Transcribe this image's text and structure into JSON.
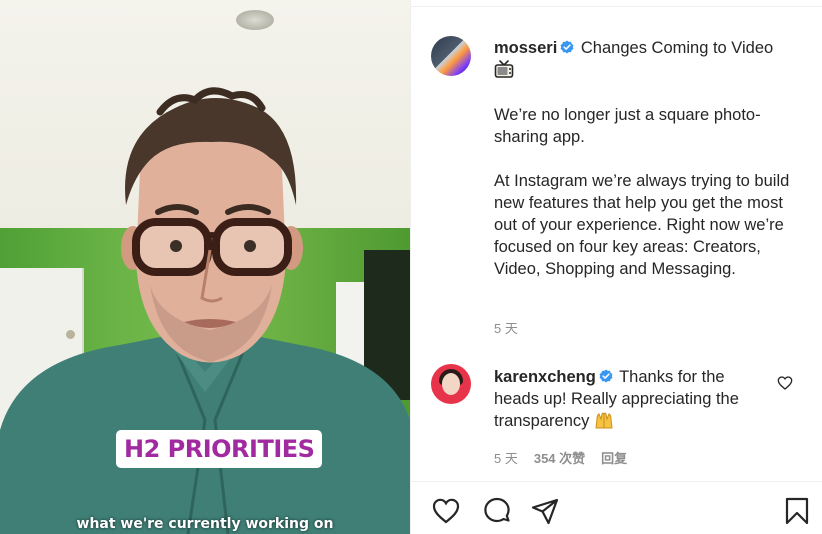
{
  "video": {
    "caption_chip": "H2 PRIORITIES",
    "subtitle": "what we're currently working on"
  },
  "post": {
    "author": "mosseri",
    "author_verified": true,
    "title": "Changes Coming to Video",
    "title_icon": "tv-icon",
    "paragraphs": [
      "We’re no longer just a square photo-sharing app.",
      "At Instagram we’re always trying to build new features that help you get the most out of your experience. Right now we’re focused on four key areas: Creators, Video, Shopping and Messaging."
    ],
    "time": "5 天"
  },
  "comment": {
    "author": "karenxcheng",
    "author_verified": true,
    "text": "Thanks for the heads up! Really appreciating the transparency",
    "emoji_icon": "raising-hands-icon",
    "time": "5 天",
    "likes": "354 次赞",
    "reply": "回复"
  },
  "actions": {
    "icons": [
      "heart-icon",
      "comment-icon",
      "share-icon",
      "bookmark-icon"
    ]
  },
  "colors": {
    "verified": "#3897f0",
    "caption_chip_text": "#a22aa1",
    "secondary_text": "#8e8e8e",
    "primary_text": "#262626"
  }
}
